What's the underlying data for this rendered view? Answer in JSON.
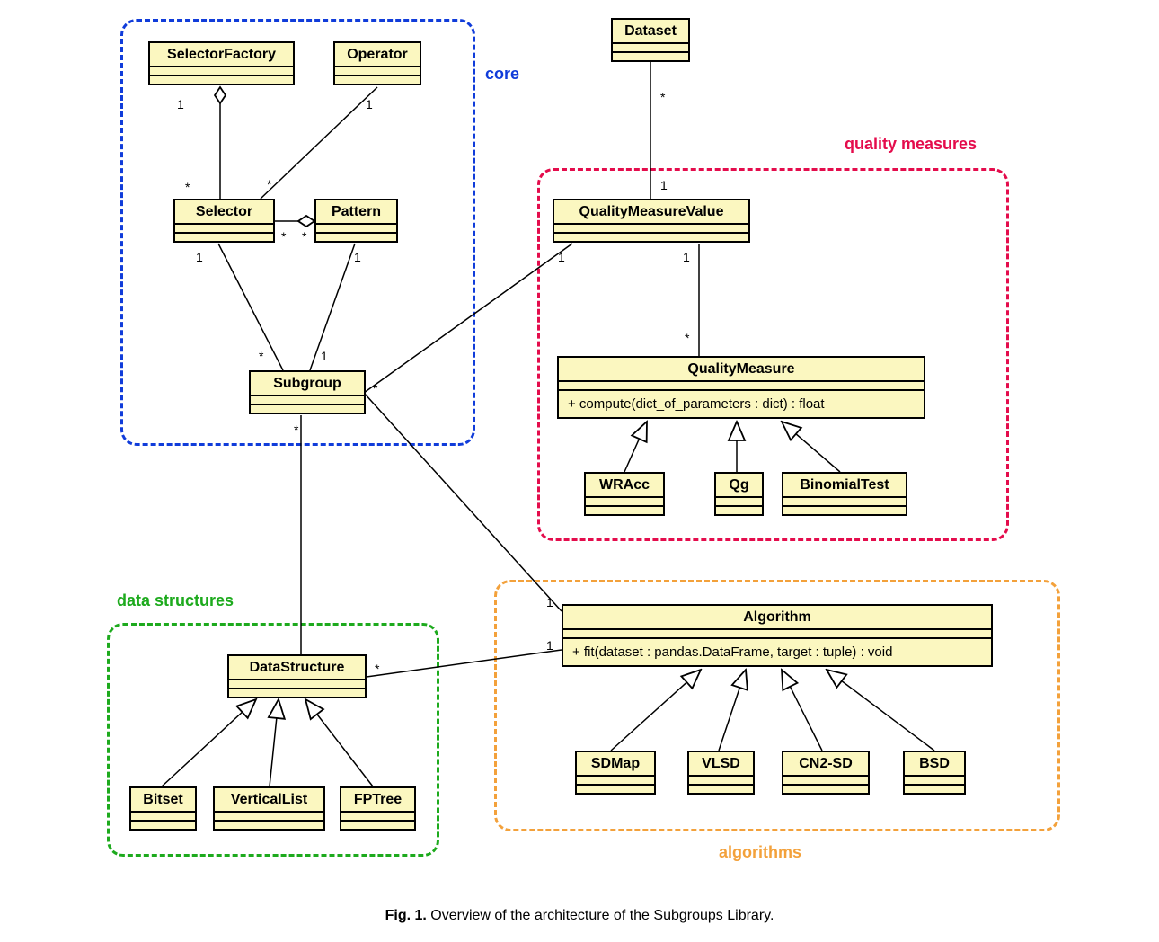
{
  "caption_bold": "Fig. 1.",
  "caption_rest": "Overview of the architecture of the Subgroups Library.",
  "packages": {
    "core": "core",
    "quality_measures": "quality measures",
    "data_structures": "data structures",
    "algorithms": "algorithms"
  },
  "classes": {
    "SelectorFactory": "SelectorFactory",
    "Operator": "Operator",
    "Selector": "Selector",
    "Pattern": "Pattern",
    "Subgroup": "Subgroup",
    "Dataset": "Dataset",
    "QualityMeasureValue": "QualityMeasureValue",
    "QualityMeasure": "QualityMeasure",
    "QualityMeasure_method": "+ compute(dict_of_parameters : dict) : float",
    "WRAcc": "WRAcc",
    "Qg": "Qg",
    "BinomialTest": "BinomialTest",
    "DataStructure": "DataStructure",
    "Bitset": "Bitset",
    "VerticalList": "VerticalList",
    "FPTree": "FPTree",
    "Algorithm": "Algorithm",
    "Algorithm_method": "+ fit(dataset : pandas.DataFrame, target : tuple) : void",
    "SDMap": "SDMap",
    "VLSD": "VLSD",
    "CN2SD": "CN2-SD",
    "BSD": "BSD"
  },
  "mult": {
    "star": "*",
    "one": "1"
  }
}
